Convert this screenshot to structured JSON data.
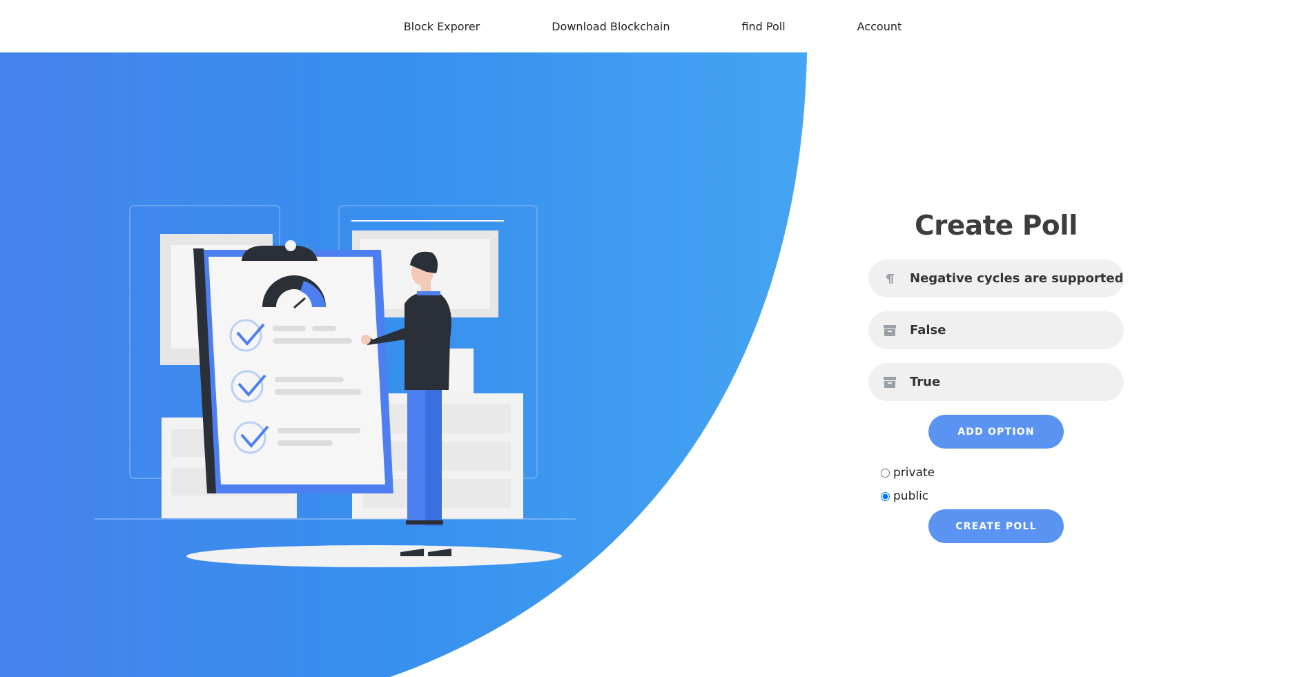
{
  "nav": {
    "items": [
      {
        "label": "Block Exporer"
      },
      {
        "label": "Download Blockchain"
      },
      {
        "label": "find Poll"
      },
      {
        "label": "Account"
      }
    ]
  },
  "form": {
    "title": "Create Poll",
    "question": {
      "value": "Negative cycles are supported by l",
      "icon": "paragraph-icon"
    },
    "options": [
      {
        "value": "False",
        "icon": "archive-icon"
      },
      {
        "value": "True",
        "icon": "archive-icon"
      }
    ],
    "add_option_label": "ADD OPTION",
    "visibility": [
      {
        "label": "private",
        "checked": false
      },
      {
        "label": "public",
        "checked": true
      }
    ],
    "create_label": "CREATE POLL"
  },
  "colors": {
    "gradient_start": "#4583ec",
    "gradient_mid": "#3790ee",
    "gradient_end": "#45a4f3",
    "button": "#5b93f2",
    "field_bg": "#f0f0f0"
  }
}
